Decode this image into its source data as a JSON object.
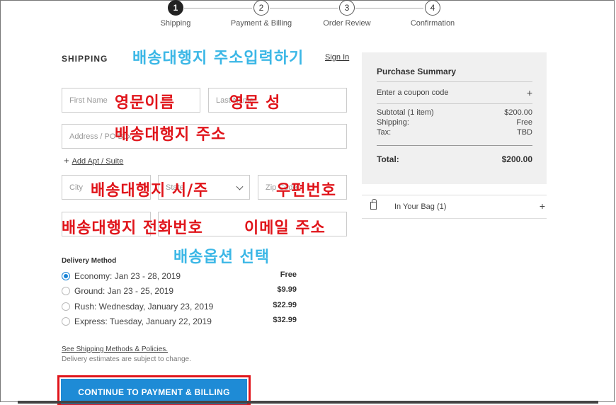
{
  "steps": [
    {
      "number": "1",
      "label": "Shipping"
    },
    {
      "number": "2",
      "label": "Payment & Billing"
    },
    {
      "number": "3",
      "label": "Order Review"
    },
    {
      "number": "4",
      "label": "Confirmation"
    }
  ],
  "shipping": {
    "title": "SHIPPING",
    "signin_link": "Sign In",
    "fields": {
      "first_name": "First Name",
      "last_name": "Last Name",
      "address": "Address / PO Box",
      "add_apt": "Add Apt / Suite",
      "city": "City",
      "state": "State",
      "zip": "Zip Code"
    }
  },
  "annotations": {
    "address_heading": "배송대행지 주소입력하기",
    "first_name": "영문이름",
    "last_name": "영문 성",
    "address": "배송대행지 주소",
    "city_state": "배송대행지 시/주",
    "zip": "우편번호",
    "phone": "배송대행지 전화번호",
    "email": "이메일 주소",
    "delivery": "배송옵션 선택"
  },
  "delivery": {
    "title": "Delivery Method",
    "options": [
      {
        "label": "Economy: Jan 23 - 28, 2019",
        "price": "Free",
        "selected": true
      },
      {
        "label": "Ground: Jan 23 - 25, 2019",
        "price": "$9.99",
        "selected": false
      },
      {
        "label": "Rush: Wednesday, January 23, 2019",
        "price": "$22.99",
        "selected": false
      },
      {
        "label": "Express: Tuesday, January 22, 2019",
        "price": "$32.99",
        "selected": false
      }
    ],
    "policy_link": "See Shipping Methods & Policies.",
    "policy_note": "Delivery estimates are subject to change."
  },
  "cta": {
    "label": "CONTINUE TO PAYMENT & BILLING"
  },
  "summary": {
    "title": "Purchase Summary",
    "coupon": "Enter a coupon code",
    "coupon_plus": "+",
    "subtotal_label": "Subtotal (1 item)",
    "subtotal_value": "$200.00",
    "shipping_label": "Shipping:",
    "shipping_value": "Free",
    "tax_label": "Tax:",
    "tax_value": "TBD",
    "total_label": "Total:",
    "total_value": "$200.00"
  },
  "bag": {
    "label": "In Your Bag (1)",
    "plus": "+"
  },
  "colors": {
    "accent": "#1e8bd6",
    "annotation_red": "#e0141a",
    "annotation_cyan": "#3bb7e6"
  }
}
